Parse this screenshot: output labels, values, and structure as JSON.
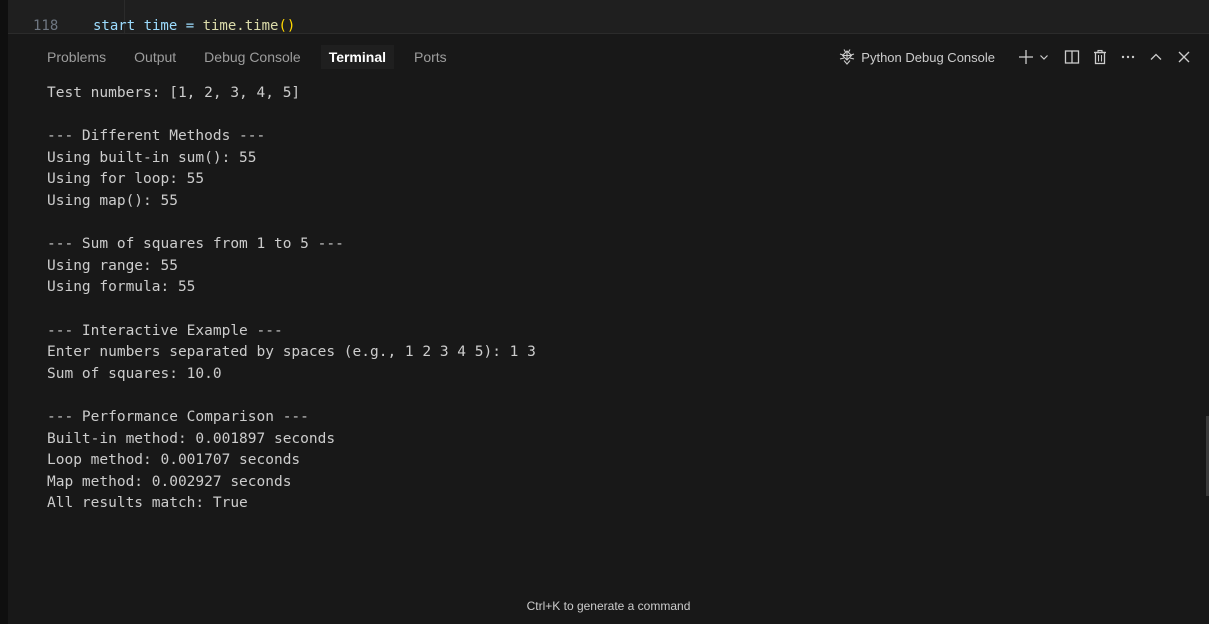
{
  "editor": {
    "line_number": "118",
    "code_prefix": "start_time = ",
    "code_func": "time.time",
    "code_parens": "()"
  },
  "panel": {
    "tabs": [
      {
        "label": "Problems",
        "active": false
      },
      {
        "label": "Output",
        "active": false
      },
      {
        "label": "Debug Console",
        "active": false
      },
      {
        "label": "Terminal",
        "active": true
      },
      {
        "label": "Ports",
        "active": false
      }
    ],
    "session_label": "Python Debug Console",
    "icons": {
      "session": "debug-bug-icon",
      "new_terminal": "plus-icon",
      "dropdown": "chevron-down-icon",
      "split": "split-terminal-icon",
      "kill": "trash-icon",
      "more": "ellipsis-icon",
      "maximize": "chevron-up-icon",
      "close": "close-icon"
    }
  },
  "terminal": {
    "lines": [
      "Test numbers: [1, 2, 3, 4, 5]",
      "",
      "--- Different Methods ---",
      "Using built-in sum(): 55",
      "Using for loop: 55",
      "Using map(): 55",
      "",
      "--- Sum of squares from 1 to 5 ---",
      "Using range: 55",
      "Using formula: 55",
      "",
      "--- Interactive Example ---",
      "Enter numbers separated by spaces (e.g., 1 2 3 4 5): 1 3",
      "Sum of squares: 10.0",
      "",
      "--- Performance Comparison ---",
      "Built-in method: 0.001897 seconds",
      "Loop method: 0.001707 seconds",
      "Map method: 0.002927 seconds",
      "All results match: True"
    ]
  },
  "hint": "Ctrl+K to generate a command",
  "colors": {
    "background": "#181818",
    "text": "#cccccc",
    "active_tab": "#ffffff",
    "inactive_tab": "#9d9d9d"
  }
}
